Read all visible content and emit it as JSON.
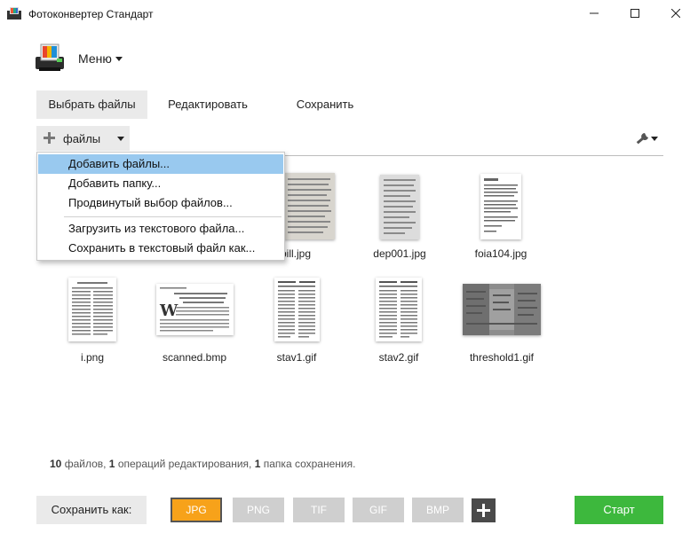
{
  "window": {
    "title": "Фотоконвертер Стандарт",
    "minimize_glyph": "—",
    "maximize_glyph": "☐",
    "close_glyph": "✕"
  },
  "menu": {
    "label": "Меню"
  },
  "tabs": [
    {
      "label": "Выбрать файлы",
      "active": true
    },
    {
      "label": "Редактировать",
      "active": false
    },
    {
      "label": "Сохранить",
      "active": false
    }
  ],
  "toolbar": {
    "add_label": "файлы",
    "settings_icon": "wrench-icon"
  },
  "dropdown": {
    "items": [
      {
        "label": "Добавить файлы...",
        "highlighted": true
      },
      {
        "label": "Добавить папку...",
        "highlighted": false
      },
      {
        "label": "Продвинутый выбор файлов...",
        "highlighted": false
      },
      {
        "label": "Загрузить из текстового файла...",
        "highlighted": false
      },
      {
        "label": "Сохранить в текстовый файл как...",
        "highlighted": false
      }
    ]
  },
  "files": [
    {
      "name": "bill.jpg",
      "label": "bill.jpg"
    },
    {
      "name": "dep001.jpg",
      "label": "dep001.jpg"
    },
    {
      "name": "foia104.jpg",
      "label": "foia104.jpg"
    },
    {
      "name": "i.png",
      "label": "i.png"
    },
    {
      "name": "scanned.bmp",
      "label": "scanned.bmp"
    },
    {
      "name": "stav1.gif",
      "label": "stav1.gif"
    },
    {
      "name": "stav2.gif",
      "label": "stav2.gif"
    },
    {
      "name": "threshold1.gif",
      "label": "threshold1.gif"
    }
  ],
  "status": {
    "files_count": "10",
    "files_text": " файлов, ",
    "edits_count": "1",
    "edits_text": " операций редактирования, ",
    "folders_count": "1",
    "folders_text": " папка сохранения."
  },
  "save_as": {
    "label": "Сохранить как:"
  },
  "formats": [
    {
      "label": "JPG",
      "selected": true
    },
    {
      "label": "PNG",
      "selected": false
    },
    {
      "label": "TIF",
      "selected": false
    },
    {
      "label": "GIF",
      "selected": false
    },
    {
      "label": "BMP",
      "selected": false
    }
  ],
  "start": {
    "label": "Старт"
  },
  "colors": {
    "accent_selected_format": "#f7a21a",
    "start_button": "#3db83d",
    "dropdown_highlight": "#99c9ef"
  }
}
